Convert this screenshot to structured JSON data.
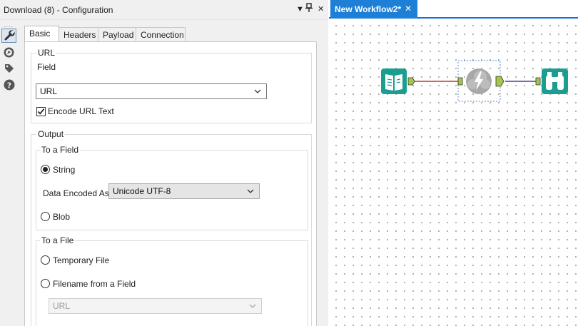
{
  "pane": {
    "title": "Download (8) - Configuration",
    "controls": {
      "dropdown": "▼",
      "pin": "📌",
      "close": "✕"
    }
  },
  "side_toolbar": {
    "grip": "....",
    "items": [
      {
        "name": "configuration-icon",
        "active": true
      },
      {
        "name": "layout-icon",
        "active": false
      },
      {
        "name": "annotation-icon",
        "active": false
      },
      {
        "name": "help-icon",
        "active": false
      }
    ]
  },
  "tabs": [
    "Basic",
    "Headers",
    "Payload",
    "Connection"
  ],
  "url_group": {
    "title": "URL",
    "field_label": "Field",
    "field_value": "URL",
    "encode_label": "Encode URL Text",
    "encode_checked": true
  },
  "output_group": {
    "title": "Output",
    "to_field": {
      "title": "To a Field",
      "string_label": "String",
      "string_selected": true,
      "encoded_label": "Data Encoded As",
      "encoded_value": "Unicode UTF-8",
      "blob_label": "Blob"
    },
    "to_file": {
      "title": "To a File",
      "temp_label": "Temporary File",
      "filename_label": "Filename from a Field",
      "filename_value": "URL"
    }
  },
  "canvas": {
    "tab_label": "New Workflow2*",
    "tab_close": "✕",
    "colors": {
      "input_tool": "#1a9e8f",
      "browse_tool": "#1a9e8f",
      "download_tool": "#a8a8a8",
      "link_in": "#c0392b",
      "link_out": "#4b3f8f",
      "tab_active": "#1e7fd6"
    }
  }
}
